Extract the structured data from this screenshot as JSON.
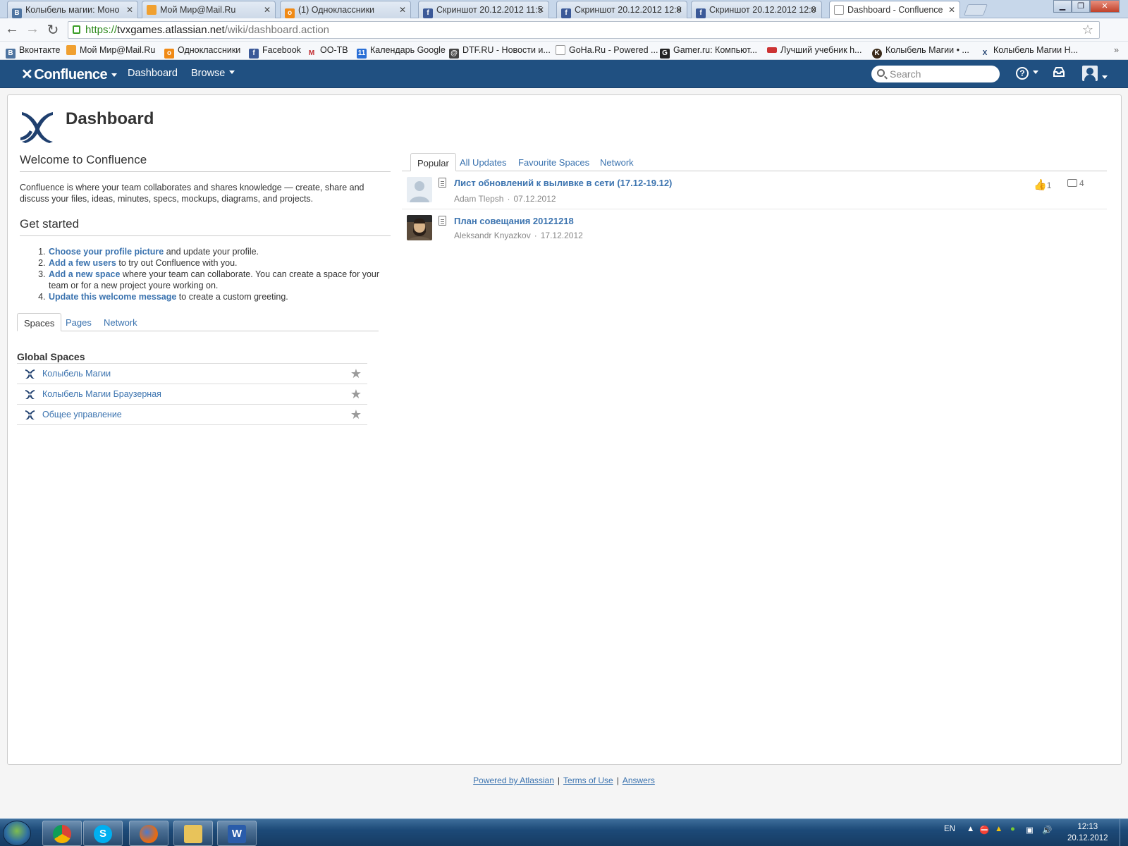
{
  "browser": {
    "tabs": [
      {
        "title": "Колыбель магии: Моно",
        "icon": "vk-icon",
        "color": "#4e74a0",
        "letter": "В"
      },
      {
        "title": "Мой Мир@Mail.Ru",
        "icon": "mailru-mymir-icon",
        "color": "#f0a030",
        "letter": ""
      },
      {
        "title": "(1) Одноклассники",
        "icon": "odnoklassniki-icon",
        "color": "#f08a16",
        "letter": "о"
      },
      {
        "title": "Скриншот 20.12.2012 11:5",
        "icon": "facebook-icon",
        "color": "#3b5998",
        "letter": "f"
      },
      {
        "title": "Скриншот 20.12.2012 12:0",
        "icon": "facebook-icon",
        "color": "#3b5998",
        "letter": "f"
      },
      {
        "title": "Скриншот 20.12.2012 12:0",
        "icon": "facebook-icon",
        "color": "#3b5998",
        "letter": "f"
      },
      {
        "title": "Dashboard - Confluence",
        "icon": "page-icon",
        "color": "#ffffff",
        "letter": ""
      }
    ],
    "url_scheme": "https://",
    "url_host": "tvxgames.atlassian.net",
    "url_path": "/wiki/dashboard.action",
    "bookmarks": [
      {
        "label": "Вконтакте",
        "color": "#4e74a0",
        "letter": "В"
      },
      {
        "label": "Мой Мир@Mail.Ru",
        "color": "#f0a030",
        "letter": ""
      },
      {
        "label": "Одноклассники",
        "color": "#f08a16",
        "letter": "о"
      },
      {
        "label": "Facebook",
        "color": "#3b5998",
        "letter": "f"
      },
      {
        "label": "ОО-ТВ",
        "color": "#c0282d",
        "letter": "M"
      },
      {
        "label": "Календарь Google",
        "color": "#2a6fd6",
        "letter": "11"
      },
      {
        "label": "DTF.RU - Новости и...",
        "color": "#444444",
        "letter": "@"
      },
      {
        "label": "GoHa.Ru - Powered ...",
        "color": "#ffffff",
        "letter": ""
      },
      {
        "label": "Gamer.ru: Компьют...",
        "color": "#222222",
        "letter": "G"
      },
      {
        "label": "Лучший учебник h...",
        "color": "#cc3333",
        "letter": ""
      },
      {
        "label": "Колыбель Магии • ...",
        "color": "#3a2a1a",
        "letter": "K"
      },
      {
        "label": "Колыбель Магии Н...",
        "color": "#1f3f6e",
        "letter": "X"
      }
    ]
  },
  "confluence": {
    "brand": "Confluence",
    "nav": {
      "dashboard": "Dashboard",
      "browse": "Browse"
    },
    "search_placeholder": "Search",
    "page_title": "Dashboard",
    "welcome": {
      "heading": "Welcome to Confluence",
      "text": "Confluence is where your team collaborates and shares knowledge — create, share and discuss your files, ideas, minutes, specs, mockups, diagrams, and projects."
    },
    "get_started": {
      "heading": "Get started",
      "steps": [
        {
          "link": "Choose your profile picture",
          "rest": " and update your profile."
        },
        {
          "link": "Add a few users",
          "rest": " to try out Confluence with you."
        },
        {
          "link": "Add a new space",
          "rest": " where your team can collaborate. You can create a space for your team or for a new project youre working on."
        },
        {
          "link": "Update this welcome message",
          "rest": " to create a custom greeting."
        }
      ]
    },
    "left_tabs": [
      "Spaces",
      "Pages",
      "Network"
    ],
    "global_spaces": {
      "heading": "Global Spaces",
      "items": [
        "Колыбель Магии",
        "Колыбель Магии Браузерная",
        "Общее управление"
      ]
    },
    "right_tabs": [
      "Popular",
      "All Updates",
      "Favourite Spaces",
      "Network"
    ],
    "feed": [
      {
        "title": "Лист обновлений к выливке в сети (17.12-19.12)",
        "author": "Adam Tlepsh",
        "date": "07.12.2012",
        "likes": "1",
        "comments": "4"
      },
      {
        "title": "План совещания 20121218",
        "author": "Aleksandr Knyazkov",
        "date": "17.12.2012",
        "likes": "",
        "comments": ""
      }
    ],
    "footer": {
      "powered": "Powered by Atlassian",
      "terms": "Terms of Use",
      "answers": "Answers"
    }
  },
  "taskbar": {
    "language": "EN",
    "time": "12:13",
    "date": "20.12.2012"
  }
}
